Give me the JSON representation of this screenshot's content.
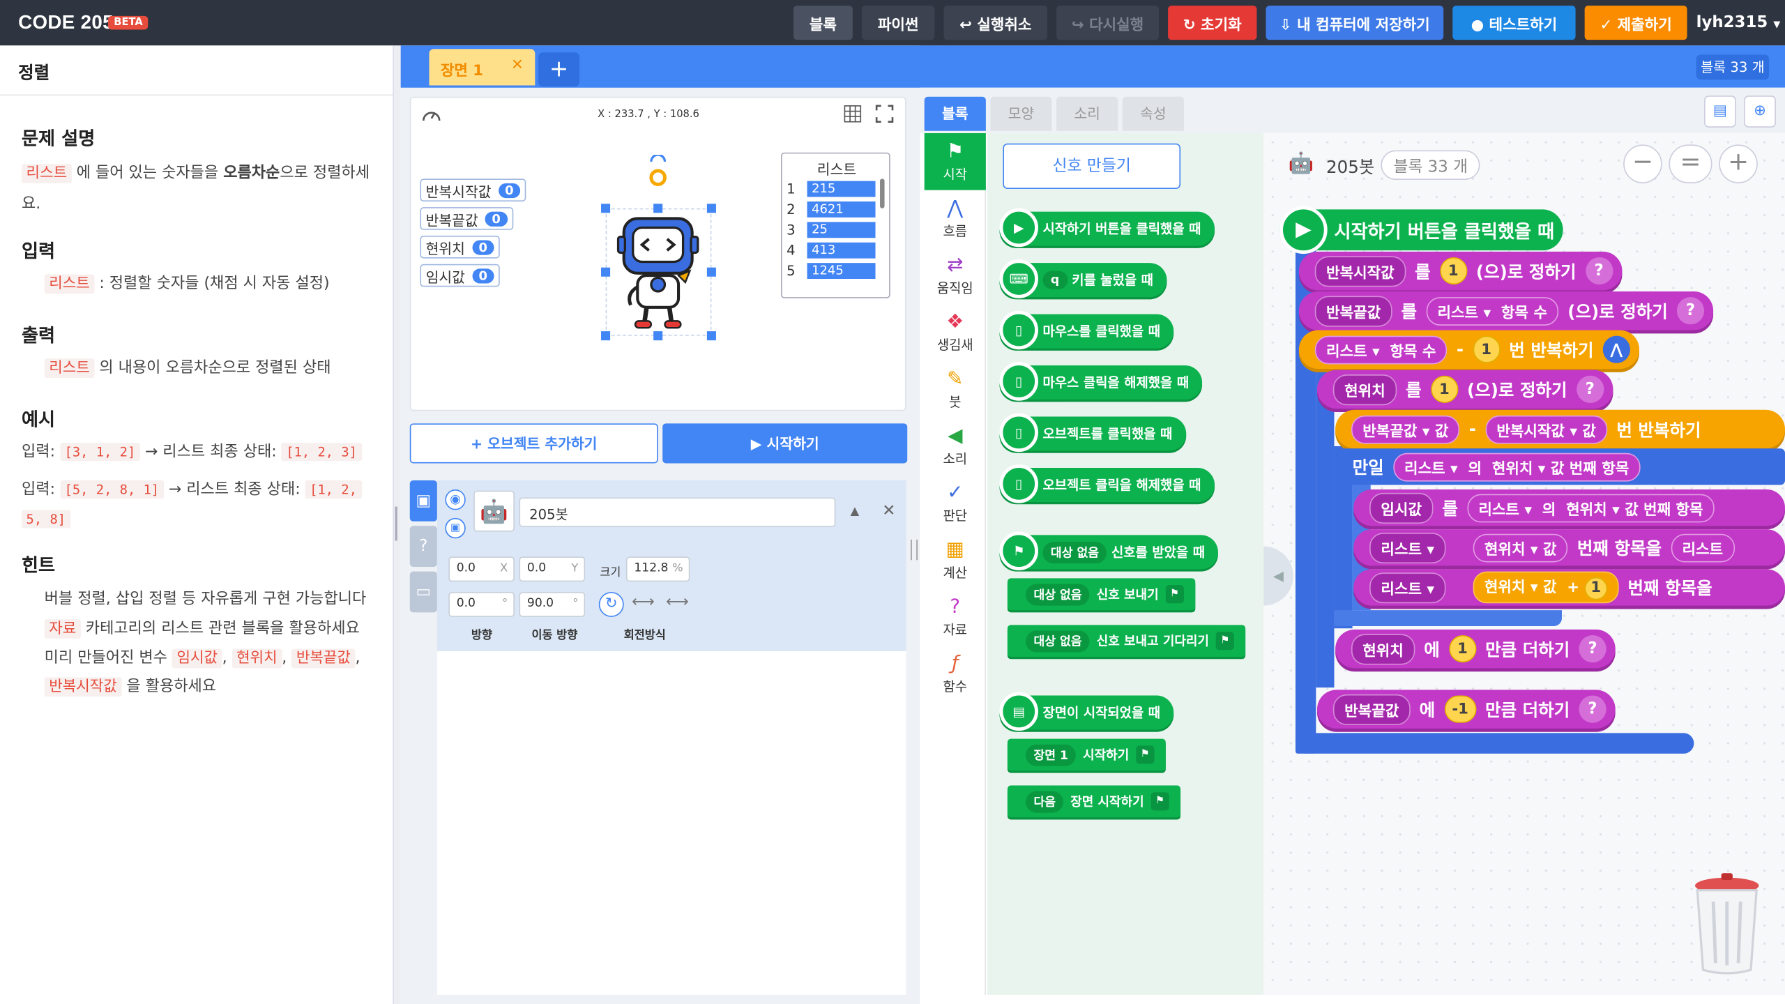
{
  "app": {
    "logo": "CODE 205",
    "beta": "BETA",
    "user": "lyh2315"
  },
  "toolbar": {
    "block_mode": "블록",
    "python_mode": "파이썬",
    "undo": "↩ 실행취소",
    "redo": "↪ 다시실행",
    "reset": "↻ 초기화",
    "save_local": "⇩ 내 컴퓨터에 저장하기",
    "test": "● 테스트하기",
    "submit": "✓ 제출하기"
  },
  "problem": {
    "title": "정렬",
    "desc_heading": "문제 설명",
    "desc_tag": "리스트",
    "desc_text1": " 에 들어 있는 숫자들을 ",
    "desc_bold": "오름차순",
    "desc_text2": "으로 정렬하세",
    "desc_text3": "요.",
    "input_heading": "입력",
    "input_tag": "리스트",
    "input_text": " : 정렬할 숫자들 (채점 시 자동 설정)",
    "output_heading": "출력",
    "output_tag": "리스트",
    "output_text": " 의 내용이 오름차순으로 정렬된 상태",
    "example_heading": "예시",
    "ex1_label": "입력:",
    "ex1_in": "[3, 1, 2]",
    "ex1_mid": "→ 리스트 최종 상태:",
    "ex1_out": "[1, 2, 3]",
    "ex2_label": "입력:",
    "ex2_in": "[5, 2, 8, 1]",
    "ex2_mid": "→ 리스트 최종 상태:",
    "ex2_out_a": "[1, 2,",
    "ex2_out_b": "5, 8]",
    "hint_heading": "힌트",
    "hint1": "버블 정렬, 삽입 정렬 등 자유롭게 구현 가능합니다",
    "hint2_tag": "자료",
    "hint2_text": " 카테고리의 리스트 관련 블록을 활용하세요",
    "hint3_text": "미리 만들어진 변수 ",
    "hint3_tag1": "임시값",
    "hint3_tag2": "현위치",
    "hint3_tag3": "반복끝값",
    "hint4_tag": "반복시작값",
    "hint4_text": " 을 활용하세요",
    "comma": ","
  },
  "scene": {
    "tab": "장면 1",
    "close": "✕",
    "add": "+",
    "block_count": "블록 33 개"
  },
  "stage": {
    "coords": "X : 233.7 , Y : 108.6",
    "variables": [
      {
        "name": "반복시작값",
        "value": "0"
      },
      {
        "name": "반복끝값",
        "value": "0"
      },
      {
        "name": "현위치",
        "value": "0"
      },
      {
        "name": "임시값",
        "value": "0"
      }
    ],
    "list": {
      "title": "리스트",
      "items": [
        {
          "n": "1",
          "v": "215"
        },
        {
          "n": "2",
          "v": "4621"
        },
        {
          "n": "3",
          "v": "25"
        },
        {
          "n": "4",
          "v": "413"
        },
        {
          "n": "5",
          "v": "1245"
        }
      ]
    }
  },
  "controls": {
    "add_object": "+ 오브젝트 추가하기",
    "start": "▶ 시작하기"
  },
  "object": {
    "name": "205봇",
    "x": "0.0",
    "x_unit": "X",
    "y": "0.0",
    "y_unit": "Y",
    "size_label": "크기",
    "size": "112.8",
    "size_unit": "%",
    "dir": "0.0",
    "dir_unit": "°",
    "move_dir": "90.0",
    "move_dir_unit": "°",
    "dir_label": "방향",
    "move_dir_label": "이동 방향",
    "rotate_label": "회전방식"
  },
  "palette": {
    "tabs": [
      "블록",
      "모양",
      "소리",
      "속성"
    ],
    "categories": [
      "시작",
      "흐름",
      "움직임",
      "생김새",
      "붓",
      "소리",
      "판단",
      "계산",
      "자료",
      "함수"
    ],
    "make_signal": "신호 만들기",
    "blocks": {
      "on_start": "시작하기 버튼을 클릭했을 때",
      "key_dd": "q",
      "key_text": "키를 눌렀을 때",
      "mouse_click": "마우스를 클릭했을 때",
      "mouse_release": "마우스 클릭을 해제했을 때",
      "obj_click": "오브젝트를 클릭했을 때",
      "obj_release": "오브젝트 클릭을 해제했을 때",
      "sig_dd": "대상 없음",
      "sig_recv": "신호를 받았을 때",
      "sig_send": "신호 보내기",
      "sig_send_wait": "신호 보내고 기다리기",
      "scene_start": "장면이 시작되었을 때",
      "scene_dd": "장면 1",
      "scene_go": "시작하기",
      "next_dd": "다음",
      "next_go": "장면 시작하기"
    }
  },
  "workspace": {
    "obj_name": "205봇",
    "count": "블록 33 개",
    "zoom_out": "−",
    "zoom_reset": "=",
    "zoom_in": "+",
    "b1": "시작하기 버튼을 클릭했을 때",
    "v_start": "반복시작값",
    "v_end": "반복끝값",
    "v_pos": "현위치",
    "v_tmp": "임시값",
    "v_list": "리스트",
    "lbl_rul": "를",
    "lbl_set": "(으)로 정하기",
    "lbl_count": "항목 수",
    "lbl_repeat": "번 반복하기",
    "lbl_val": "값",
    "lbl_minus": "-",
    "lbl_plus": "+",
    "lbl_if": "만일",
    "lbl_ui": "의",
    "lbl_nth": "번째 항목",
    "lbl_nth_ul": "번째 항목을",
    "lbl_add_to": "에",
    "lbl_add": "만큼 더하기",
    "one": "1",
    "neg1": "-1",
    "q": "?"
  }
}
